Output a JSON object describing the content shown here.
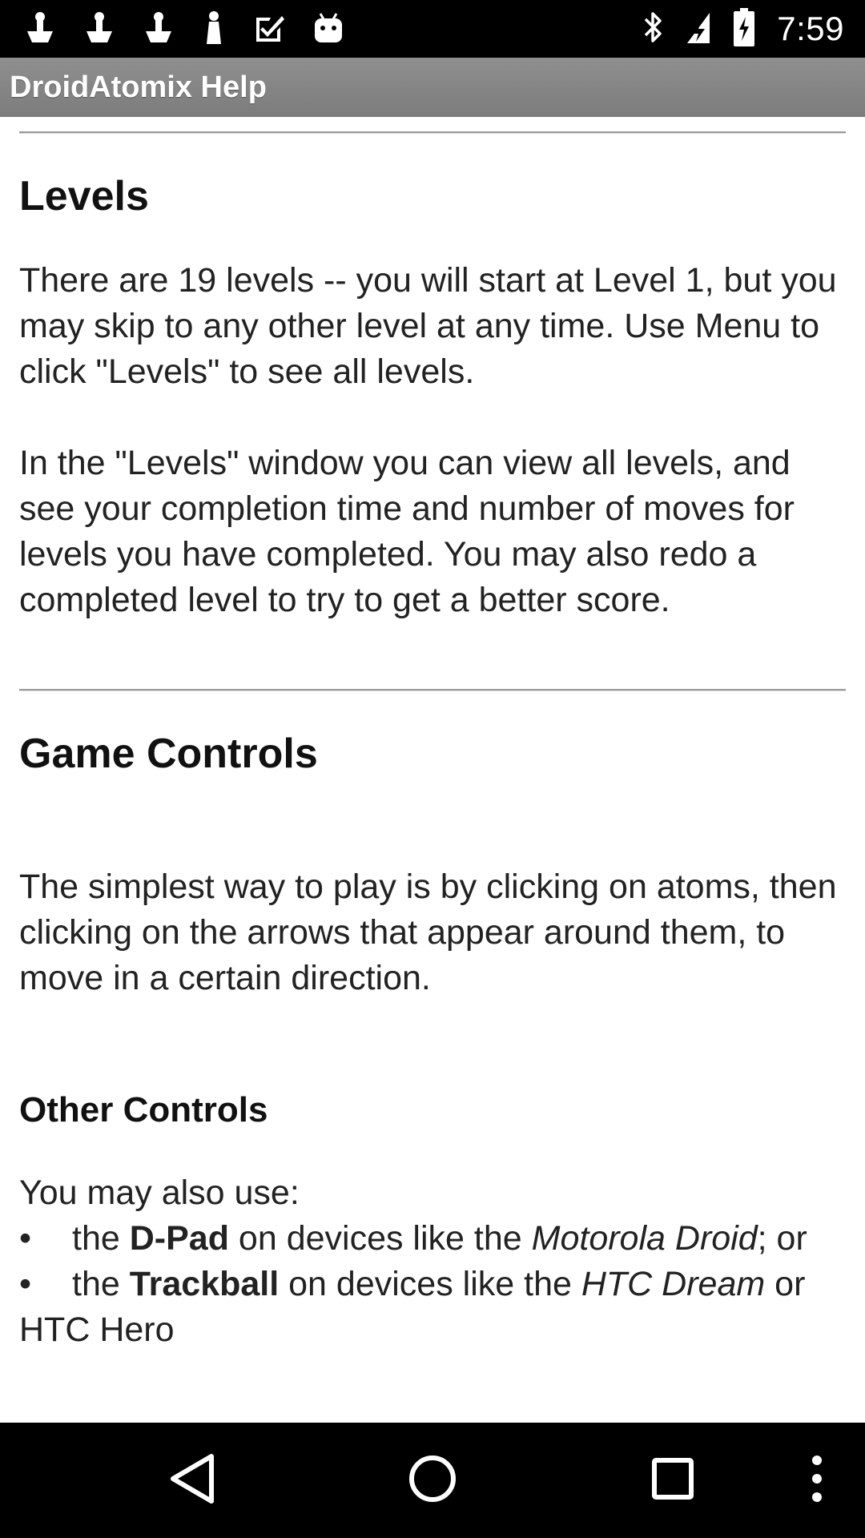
{
  "status_bar": {
    "time": "7:59",
    "icons": [
      "notification-icon",
      "notification-icon",
      "notification-icon",
      "notification-icon",
      "checkmark-icon",
      "android-icon",
      "bluetooth-icon",
      "signal-icon",
      "battery-icon"
    ]
  },
  "app": {
    "title": "DroidAtomix Help"
  },
  "help": {
    "levels": {
      "heading": "Levels",
      "para1": "There are 19 levels -- you will start at Level 1, but you may skip to any other level at any time. Use Menu to click \"Levels\" to see all levels.",
      "para2": "In the \"Levels\" window you can view all levels, and see your completion time and number of moves for levels you have completed. You may also redo a completed level to try to get a better score."
    },
    "game_controls": {
      "heading": "Game Controls",
      "para": "The simplest way to play is by clicking on atoms, then clicking on the arrows that appear around them, to move in a certain direction."
    },
    "other_controls": {
      "heading": "Other Controls",
      "intro": "You may also use:",
      "bullet_symbol": "•",
      "items": [
        {
          "pre": "the ",
          "bold": "D-Pad",
          "mid": " on devices like the ",
          "italic": "Motorola Droid",
          "post": "; or"
        },
        {
          "pre": "the ",
          "bold": "Trackball",
          "mid": " on devices like the ",
          "italic": "HTC Dream",
          "post": " or HTC Hero"
        }
      ]
    }
  },
  "nav_bar": {
    "buttons": [
      "back-icon",
      "home-icon",
      "recents-icon",
      "menu-icon"
    ]
  }
}
